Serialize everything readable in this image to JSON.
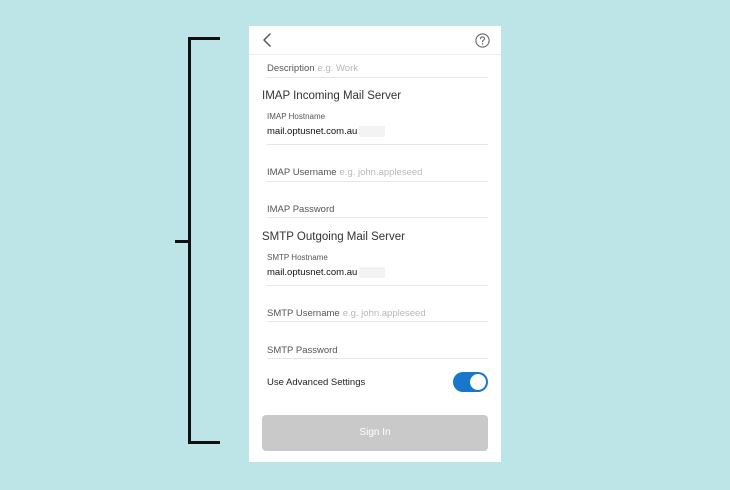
{
  "nav": {
    "back_icon": "chevron-left-icon",
    "help_icon": "question-circle-icon"
  },
  "description": {
    "label": "Description",
    "placeholder": "e.g. Work"
  },
  "imap": {
    "heading": "IMAP Incoming Mail Server",
    "hostname_label": "IMAP Hostname",
    "hostname_value": "mail.optusnet.com.au",
    "username_label": "IMAP Username",
    "username_placeholder": "e.g. john.appleseed",
    "password_label": "IMAP Password"
  },
  "smtp": {
    "heading": "SMTP Outgoing Mail Server",
    "hostname_label": "SMTP Hostname",
    "hostname_value": "mail.optusnet.com.au",
    "username_label": "SMTP Username",
    "username_placeholder": "e.g. john.appleseed",
    "password_label": "SMTP Password"
  },
  "advanced": {
    "label": "Use Advanced Settings",
    "enabled": true
  },
  "sign_in": {
    "label": "Sign In"
  },
  "colors": {
    "background": "#bde5e8",
    "toggle_on": "#1677cc",
    "button_disabled": "#c9c9c9",
    "bracket": "#111111"
  }
}
